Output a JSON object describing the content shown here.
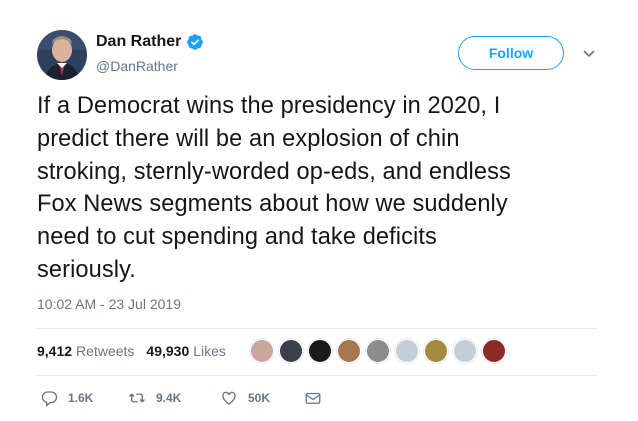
{
  "author": {
    "display_name": "Dan Rather",
    "handle": "@DanRather",
    "verified": true
  },
  "follow_label": "Follow",
  "tweet": {
    "text": "If a Democrat wins the presidency in 2020, I\npredict there will be an explosion of chin\nstroking, sternly-worded op-eds, and endless\nFox News segments about how we suddenly\nneed to cut spending and take deficits\nseriously.",
    "timestamp": "10:02 AM - 23 Jul 2019"
  },
  "stats": {
    "retweets_count": "9,412",
    "retweets_label": "Retweets",
    "likes_count": "49,930",
    "likes_label": "Likes"
  },
  "likers": [
    {
      "icon": "liker-avatar-1",
      "color": "#c9a79a"
    },
    {
      "icon": "liker-avatar-2",
      "color": "#3b3f4a"
    },
    {
      "icon": "liker-avatar-3",
      "color": "#1b1b1b"
    },
    {
      "icon": "liker-avatar-4",
      "color": "#a7774e"
    },
    {
      "icon": "liker-avatar-5",
      "color": "#8c8c8c"
    },
    {
      "icon": "liker-avatar-6",
      "color": "#c5cfd6"
    },
    {
      "icon": "liker-avatar-7",
      "color": "#a48a3e"
    },
    {
      "icon": "liker-avatar-8",
      "color": "#c5cfd6"
    },
    {
      "icon": "liker-avatar-9",
      "color": "#8a2a23"
    }
  ],
  "actions": {
    "reply_count": "1.6K",
    "retweet_count": "9.4K",
    "like_count": "50K"
  },
  "colors": {
    "accent": "#1da1f2",
    "secondary_text": "#657786",
    "primary_text": "#14171a"
  }
}
